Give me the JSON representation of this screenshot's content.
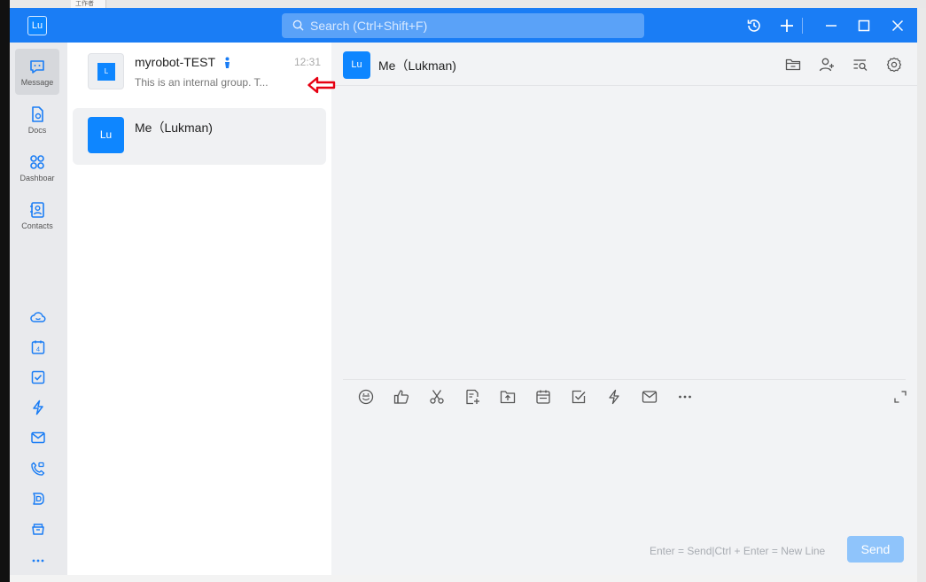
{
  "background": {
    "tab_text": "工作者"
  },
  "titlebar": {
    "avatar_text": "Lu",
    "search_placeholder": "Search (Ctrl+Shift+F)",
    "icons": [
      "history-icon",
      "plus-icon",
      "minimize-icon",
      "maximize-icon",
      "close-icon"
    ]
  },
  "nav": {
    "items": [
      {
        "label": "Message",
        "icon": "message-icon"
      },
      {
        "label": "Docs",
        "icon": "docs-icon"
      },
      {
        "label": "Dashboar",
        "icon": "dashboard-icon"
      },
      {
        "label": "Contacts",
        "icon": "contacts-icon"
      }
    ],
    "calendar_day": "4"
  },
  "conversations": [
    {
      "name": "myrobot-TEST",
      "time": "12:31",
      "preview": "This is an internal group. T...",
      "avatar_text": "L"
    },
    {
      "name": "Me（Lukman)",
      "avatar_text": "Lu"
    }
  ],
  "chat": {
    "avatar_text": "Lu",
    "title": "Me（Lukman)",
    "hint": "Enter = Send|Ctrl + Enter = New Line",
    "send_label": "Send"
  },
  "colors": {
    "titlebar": "#1a7df5",
    "accent": "#0e86ff",
    "send_disabled": "#8fc4fb",
    "annotation_arrow": "#e60012"
  }
}
